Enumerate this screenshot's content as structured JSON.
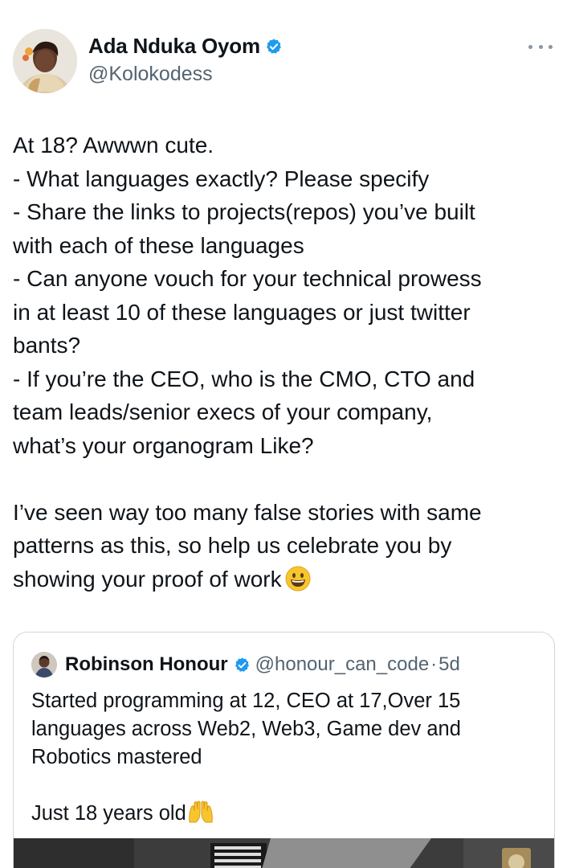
{
  "author": {
    "name": "Ada Nduka Oyom",
    "handle": "@Kolokodess",
    "verified": true
  },
  "icons": {
    "more": "more-horizontal-icon",
    "verified": "verified-badge-icon"
  },
  "tweet": {
    "lines": [
      "At 18? Awwwn cute.",
      "- What languages exactly? Please specify",
      "- Share the links to projects(repos) you’ve built",
      "with each of these languages",
      "- Can anyone vouch for your technical prowess",
      "in at least 10 of these languages or just twitter",
      "bants?",
      "- If you’re the CEO, who is the CMO, CTO and",
      "team leads/senior execs of your company,",
      "what’s your organogram Like?",
      "",
      "I’ve seen way too many false stories with same",
      "patterns as this, so help us celebrate you by",
      "showing your proof of work"
    ],
    "emoji": "grinning-face-emoji"
  },
  "quoted_tweet": {
    "name": "Robinson Honour",
    "handle": "@honour_can_code",
    "separator": "·",
    "time": "5d",
    "lines": [
      "Started programming at 12, CEO at 17,Over 15",
      "languages across Web2, Web3, Game dev and",
      "Robotics mastered",
      "",
      "Just 18 years old"
    ],
    "emoji": "raising-hands-emoji"
  },
  "colors": {
    "text": "#0f1419",
    "secondary": "#536471",
    "verified": "#1d9bf0",
    "border": "#cfd9de"
  }
}
